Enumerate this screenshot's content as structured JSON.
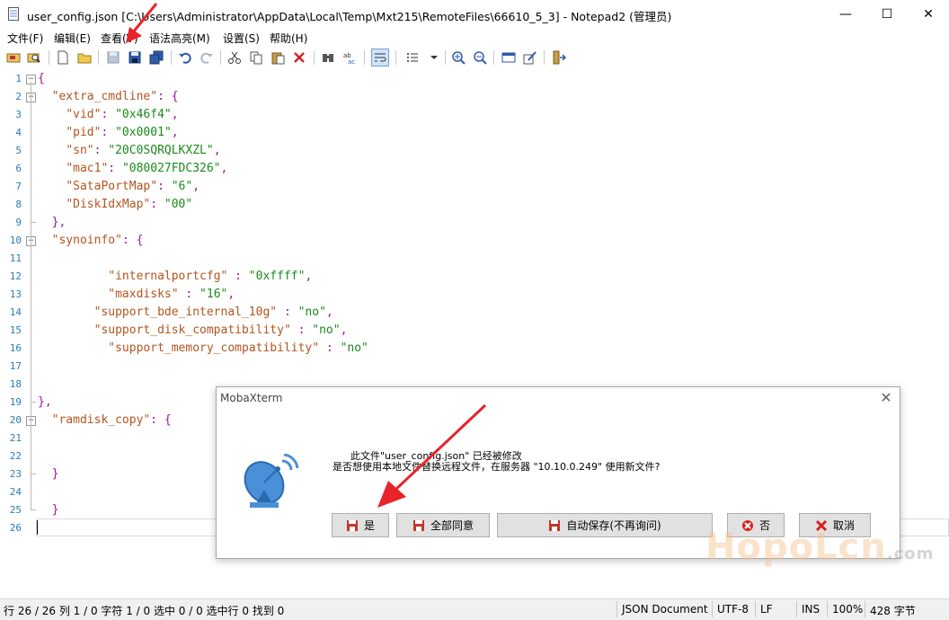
{
  "window": {
    "title": "user_config.json [C:\\Users\\Administrator\\AppData\\Local\\Temp\\Mxt215\\RemoteFiles\\66610_5_3] - Notepad2 (管理员)",
    "minimize": "—",
    "maximize": "☐",
    "close": "✕"
  },
  "menu": [
    "文件(F)",
    "编辑(E)",
    "查看(V)",
    "语法高亮(M)",
    "设置(S)",
    "帮助(H)"
  ],
  "toolbar_icons": [
    "open-browser-icon",
    "find-file-icon",
    "new-file-icon",
    "open-file-icon",
    "save-icon",
    "save-as-icon",
    "save-all-icon",
    "undo-icon",
    "redo-icon",
    "cut-icon",
    "copy-icon",
    "paste-icon",
    "delete-icon",
    "find-icon",
    "replace-icon",
    "word-wrap-icon",
    "format-icon",
    "dropdown-icon",
    "zoom-in-icon",
    "zoom-out-icon",
    "scheme-icon",
    "settings-icon",
    "exit-icon"
  ],
  "editor": {
    "lines": [
      {
        "n": "1",
        "text": "{"
      },
      {
        "n": "2",
        "text": "  \"extra_cmdline\": {"
      },
      {
        "n": "3",
        "text": "    \"vid\": \"0x46f4\","
      },
      {
        "n": "4",
        "text": "    \"pid\": \"0x0001\","
      },
      {
        "n": "5",
        "text": "    \"sn\": \"20C0SQRQLKXZL\","
      },
      {
        "n": "6",
        "text": "    \"mac1\": \"080027FDC326\","
      },
      {
        "n": "7",
        "text": "    \"SataPortMap\": \"6\","
      },
      {
        "n": "8",
        "text": "    \"DiskIdxMap\": \"00\""
      },
      {
        "n": "9",
        "text": "  },"
      },
      {
        "n": "10",
        "text": "  \"synoinfo\": {"
      },
      {
        "n": "11",
        "text": ""
      },
      {
        "n": "12",
        "text": "          \"internalportcfg\" : \"0xffff\","
      },
      {
        "n": "13",
        "text": "          \"maxdisks\" : \"16\","
      },
      {
        "n": "14",
        "text": "        \"support_bde_internal_10g\" : \"no\","
      },
      {
        "n": "15",
        "text": "        \"support_disk_compatibility\" : \"no\","
      },
      {
        "n": "16",
        "text": "          \"support_memory_compatibility\" : \"no\""
      },
      {
        "n": "17",
        "text": ""
      },
      {
        "n": "18",
        "text": ""
      },
      {
        "n": "19",
        "text": "},"
      },
      {
        "n": "20",
        "text": "  \"ramdisk_copy\": {"
      },
      {
        "n": "21",
        "text": ""
      },
      {
        "n": "22",
        "text": ""
      },
      {
        "n": "23",
        "text": "  }"
      },
      {
        "n": "24",
        "text": ""
      },
      {
        "n": "25",
        "text": "  }"
      },
      {
        "n": "26",
        "text": ""
      }
    ]
  },
  "status": {
    "position": "行 26 / 26  列 1 / 0  字符 1 / 0  选中 0 / 0  选中行 0  找到 0",
    "doctype": "JSON Document",
    "encoding": "UTF-8",
    "eol": "LF",
    "ins": "INS",
    "zoom": "100%",
    "size": "428 字节"
  },
  "dialog": {
    "title": "MobaXterm",
    "line1": "此文件\"user_config.json\" 已经被修改",
    "line2": "是否想使用本地文件替换远程文件，在服务器 \"10.10.0.249\" 使用新文件?",
    "btn_yes": "是",
    "btn_all": "全部同意",
    "btn_auto": "自动保存(不再询问)",
    "btn_no": "否",
    "btn_cancel": "取消"
  },
  "watermark": {
    "main": "HopoLcn",
    "domain": ".com"
  },
  "colors": {
    "key": "#b3541e",
    "string": "#1a8a1a",
    "punct": "#a0149f",
    "line_number": "#2b7bb9",
    "arrow": "#e8232a"
  }
}
